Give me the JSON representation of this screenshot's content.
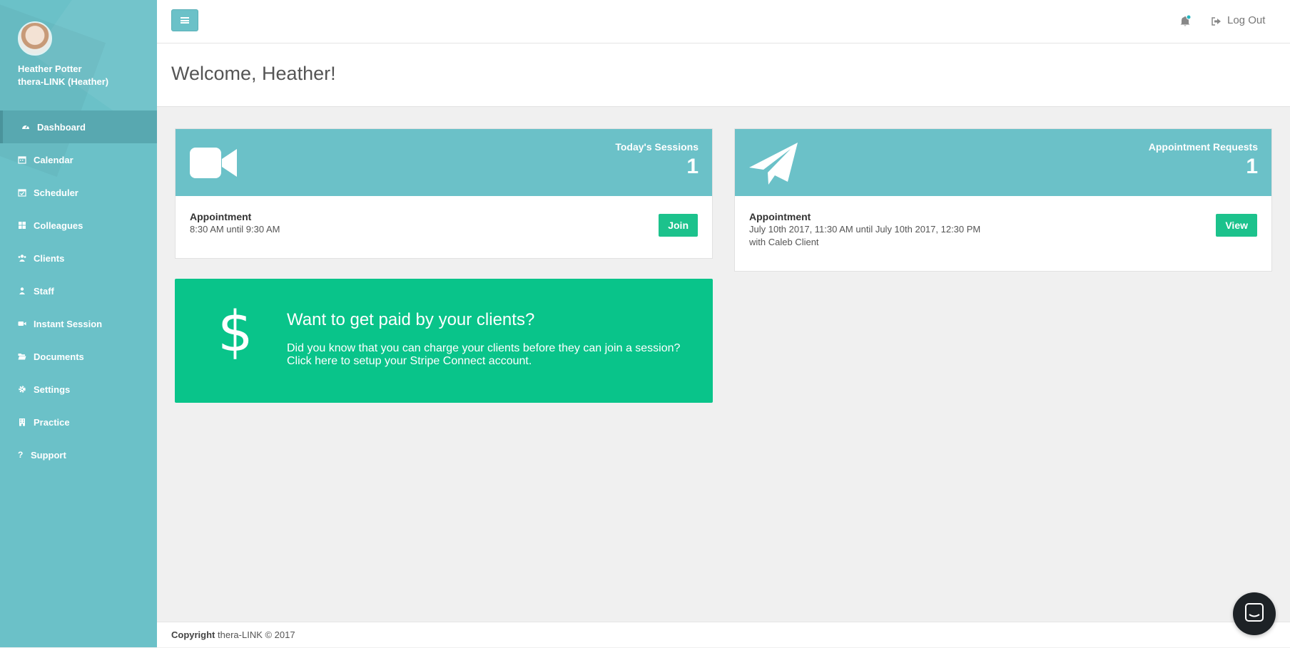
{
  "profile": {
    "name": "Heather Potter",
    "org": "thera-LINK (Heather)"
  },
  "sidebar": {
    "items": [
      {
        "label": "Dashboard",
        "icon": "dashboard-icon",
        "active": true
      },
      {
        "label": "Calendar",
        "icon": "calendar-icon"
      },
      {
        "label": "Scheduler",
        "icon": "calendar-check-icon"
      },
      {
        "label": "Colleagues",
        "icon": "grid-icon"
      },
      {
        "label": "Clients",
        "icon": "users-icon"
      },
      {
        "label": "Staff",
        "icon": "user-badge-icon"
      },
      {
        "label": "Instant Session",
        "icon": "video-icon"
      },
      {
        "label": "Documents",
        "icon": "folder-open-icon"
      },
      {
        "label": "Settings",
        "icon": "gear-icon"
      },
      {
        "label": "Practice",
        "icon": "building-icon"
      },
      {
        "label": "Support",
        "icon": "question-icon"
      }
    ]
  },
  "header": {
    "logout_label": "Log Out",
    "has_notification": true
  },
  "page": {
    "title": "Welcome, Heather!"
  },
  "sessions_card": {
    "label": "Today's Sessions",
    "count": "1",
    "icon": "video-camera-icon",
    "appointment_title": "Appointment",
    "appointment_time": "8:30 AM until 9:30 AM",
    "button_label": "Join"
  },
  "requests_card": {
    "label": "Appointment Requests",
    "count": "1",
    "icon": "paper-plane-icon",
    "appointment_title": "Appointment",
    "appointment_time": "July 10th 2017, 11:30 AM until July 10th 2017, 12:30 PM",
    "appointment_with": "with Caleb Client",
    "button_label": "View"
  },
  "promo": {
    "icon": "dollar-icon",
    "symbol": "$",
    "title": "Want to get paid by your clients?",
    "text": "Did you know that you can charge your clients before they can join a session? Click here to setup your Stripe Connect account."
  },
  "footer": {
    "copyright_label": "Copyright",
    "copyright_text": "thera-LINK © 2017"
  },
  "colors": {
    "sidebar": "#6bc1c8",
    "accent_green": "#1cc28c",
    "promo_green": "#09c48a"
  }
}
